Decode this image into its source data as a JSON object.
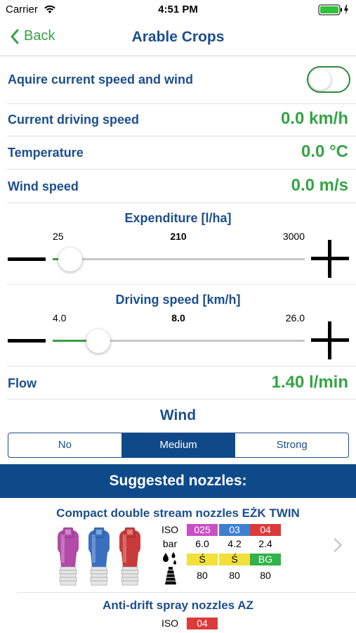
{
  "status_bar": {
    "carrier": "Carrier",
    "time": "4:51 PM"
  },
  "nav": {
    "back_label": "Back",
    "title": "Arable Crops"
  },
  "acquire": {
    "label": "Aquire current speed and wind",
    "toggle_on": false
  },
  "readings": [
    {
      "label": "Current driving speed",
      "value": "0.0 km/h"
    },
    {
      "label": "Temperature",
      "value": "0.0 °C"
    },
    {
      "label": "Wind speed",
      "value": "0.0 m/s"
    }
  ],
  "expenditure": {
    "title": "Expenditure [l/ha]",
    "min": "25",
    "current": "210",
    "max": "3000",
    "fraction": 0.07
  },
  "driving_speed": {
    "title": "Driving speed [km/h]",
    "min": "4.0",
    "current": "8.0",
    "max": "26.0",
    "fraction": 0.18
  },
  "flow": {
    "label": "Flow",
    "value": "1.40 l/min"
  },
  "wind": {
    "title": "Wind",
    "options": [
      "No",
      "Medium",
      "Strong"
    ],
    "selected": "Medium"
  },
  "suggested_header": "Suggested nozzles:",
  "nozzles": [
    {
      "name": "Compact double stream nozzles EŻK TWIN",
      "iso_label": "ISO",
      "bar_label": "bar",
      "iso": [
        {
          "text": "025",
          "color": "#c84fc4"
        },
        {
          "text": "03",
          "color": "#3f7fd0"
        },
        {
          "text": "04",
          "color": "#dc3a3a"
        }
      ],
      "bar": [
        "6.0",
        "4.2",
        "2.4"
      ],
      "drops": [
        {
          "text": "Ś",
          "color": "#f2e03a"
        },
        {
          "text": "Ś",
          "color": "#f2e03a"
        },
        {
          "text": "BG",
          "color": "#2fb34a"
        }
      ],
      "drift": [
        "80",
        "80",
        "80"
      ],
      "tip_colors": [
        "#b24aa8",
        "#3a6fc0",
        "#c83a3a"
      ]
    },
    {
      "name": "Anti-drift spray nozzles AZ",
      "iso_label": "ISO",
      "iso": [
        {
          "text": "04",
          "color": "#dc3a3a"
        }
      ]
    }
  ],
  "colors": {
    "accent_green": "#34a444",
    "brand_blue": "#1c4f8c",
    "banner_blue": "#0e4a8a"
  }
}
